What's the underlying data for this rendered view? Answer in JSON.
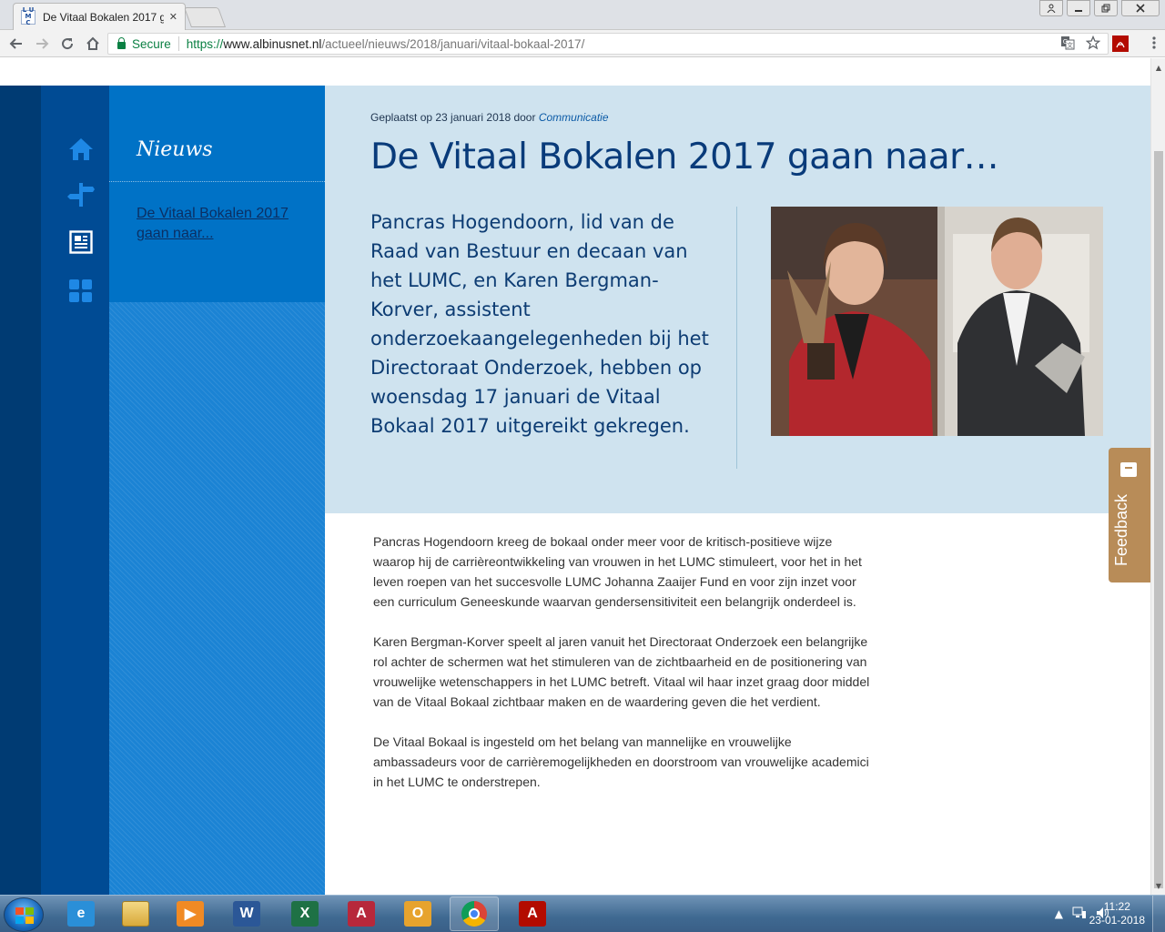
{
  "browser": {
    "tab_title": "De Vitaal Bokalen 2017 g",
    "tab_close": "✕",
    "favicon_text": "LUMC",
    "security_label": "Secure",
    "url_scheme": "https://",
    "url_host": "www.albinusnet.nl",
    "url_path": "/actueel/nieuws/2018/januari/vitaal-bokaal-2017/"
  },
  "sidebar": {
    "icons": [
      "home-icon",
      "signpost-icon",
      "news-icon",
      "grid-icon"
    ],
    "active_icon": "news-icon"
  },
  "subnav": {
    "title": "Nieuws",
    "items": [
      {
        "label": "De Vitaal Bokalen 2017 gaan naar..."
      }
    ]
  },
  "article": {
    "meta_prefix": "Geplaatst op 23 januari 2018 door",
    "meta_author": "Communicatie",
    "title": "De Vitaal Bokalen 2017 gaan naar…",
    "lead": "Pancras Hogendoorn, lid van de Raad van Bestuur en decaan van het LUMC, en Karen Bergman-Korver, assistent onderzoekaangelegenheden bij het Directoraat Onderzoek, hebben op woensdag 17 januari de Vitaal Bokaal 2017 uitgereikt gekregen.",
    "paragraphs": [
      "Pancras Hogendoorn kreeg de bokaal onder meer voor de kritisch-positieve wijze waarop hij de carrièreontwikkeling van vrouwen in het LUMC stimuleert, voor het in het leven roepen van het succesvolle LUMC Johanna Zaaijer Fund en voor zijn inzet voor een curriculum Geneeskunde waarvan gendersensitiviteit een belangrijk onderdeel is.",
      "Karen Bergman-Korver speelt al jaren vanuit het Directoraat Onderzoek een belangrijke rol achter de schermen wat het stimuleren van de zichtbaarheid en de positionering van vrouwelijke wetenschappers in het LUMC betreft. Vitaal wil haar inzet graag door middel van de Vitaal Bokaal zichtbaar maken en de waardering geven die het verdient.",
      "De Vitaal Bokaal is ingesteld om het belang van mannelijke en vrouwelijke ambassadeurs voor de carrièremogelijkheden en doorstroom van vrouwelijke academici in het LUMC te onderstrepen."
    ]
  },
  "feedback": {
    "label": "Feedback"
  },
  "taskbar": {
    "apps": [
      {
        "name": "internet-explorer",
        "glyph": "e",
        "color": "#2a8fd8"
      },
      {
        "name": "file-explorer",
        "glyph": "",
        "color": "#e8c25a"
      },
      {
        "name": "media-player",
        "glyph": "▶",
        "color": "#f08a24"
      },
      {
        "name": "word",
        "glyph": "W",
        "color": "#2b5797"
      },
      {
        "name": "excel",
        "glyph": "X",
        "color": "#1e7145"
      },
      {
        "name": "access",
        "glyph": "A",
        "color": "#b7283b"
      },
      {
        "name": "outlook",
        "glyph": "O",
        "color": "#e7a32d"
      },
      {
        "name": "chrome",
        "glyph": "",
        "color": "#db4437"
      },
      {
        "name": "acrobat",
        "glyph": "A",
        "color": "#b30b00"
      }
    ],
    "time": "11:22",
    "date": "23-01-2018"
  },
  "colors": {
    "rail_dark": "#003b73",
    "rail": "#004b94",
    "subnav": "#0072c6",
    "hero_bg": "#cfe3ef",
    "headline": "#093b7a",
    "feedback": "#b88c58"
  }
}
